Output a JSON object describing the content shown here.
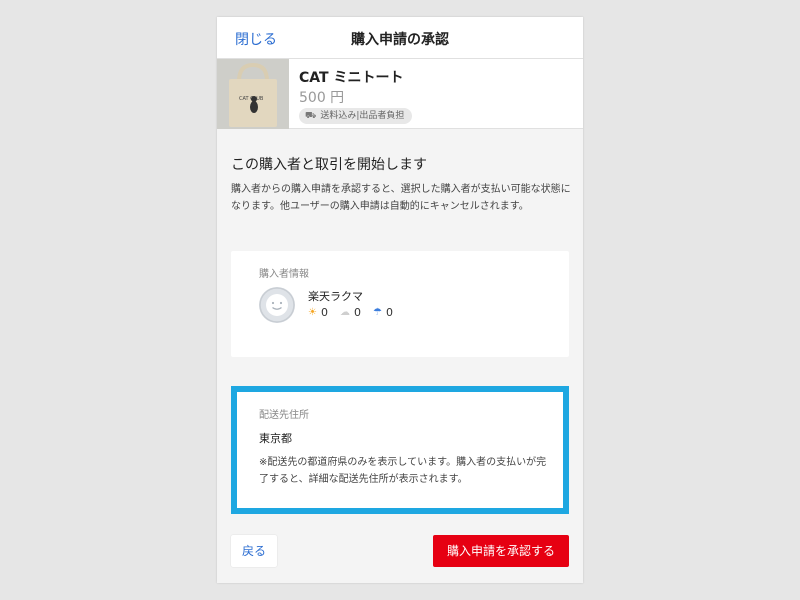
{
  "header": {
    "close_label": "閉じる",
    "title": "購入申請の承認"
  },
  "product": {
    "name": "CAT ミニトート",
    "price": "500 円",
    "shipping_badge": "送料込み|出品者負担",
    "shipping_icon": "truck-icon",
    "thumbnail_text": "CAT CLUB"
  },
  "intro": {
    "title": "この購入者と取引を開始します",
    "description": "購入者からの購入申請を承認すると、選択した購入者が支払い可能な状態になります。他ユーザーの購入申請は自動的にキャンセルされます。"
  },
  "buyer": {
    "label": "購入者情報",
    "name": "楽天ラクマ",
    "ratings": [
      {
        "icon": "sun-icon",
        "glyph": "☀",
        "color": "#f5a623",
        "count": "0"
      },
      {
        "icon": "cloud-icon",
        "glyph": "☁",
        "color": "#cfcfcf",
        "count": "0"
      },
      {
        "icon": "umbrella-icon",
        "glyph": "☂",
        "color": "#3b7ddd",
        "count": "0"
      }
    ]
  },
  "address": {
    "label": "配送先住所",
    "prefecture": "東京都",
    "note": "※配送先の都道府県のみを表示しています。購入者の支払いが完了すると、詳細な配送先住所が表示されます。"
  },
  "actions": {
    "back_label": "戻る",
    "approve_label": "購入申請を承認する"
  },
  "colors": {
    "accent": "#2b6dd1",
    "approve": "#e60012",
    "highlight": "#1ea7e1"
  }
}
